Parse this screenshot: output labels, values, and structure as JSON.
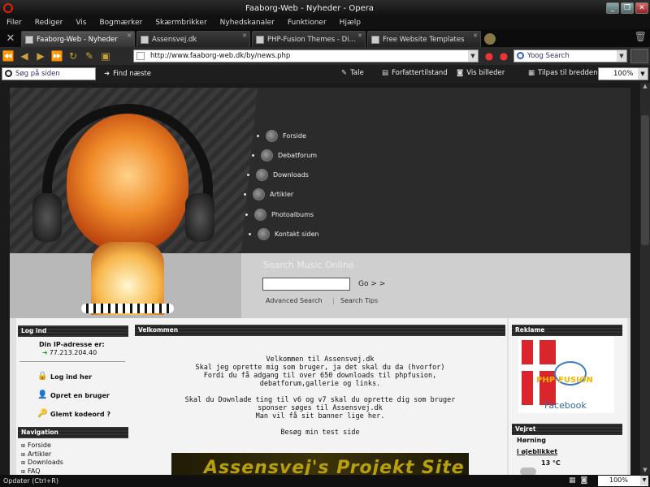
{
  "window": {
    "title": "Faaborg-Web - Nyheder - Opera",
    "buttons": [
      "_",
      "❐",
      "✕"
    ]
  },
  "menubar": [
    "Filer",
    "Rediger",
    "Vis",
    "Bogmærker",
    "Skærmbrikker",
    "Nyhedskanaler",
    "Funktioner",
    "Hjælp"
  ],
  "tabs": [
    {
      "label": "Faaborg-Web - Nyheder",
      "active": true
    },
    {
      "label": "Assensvej.dk",
      "active": false
    },
    {
      "label": "PHP-Fusion Themes - Di...",
      "active": false
    },
    {
      "label": "Free Website Templates",
      "active": false
    }
  ],
  "address": {
    "url": "http://www.faaborg-web.dk/by/news.php"
  },
  "search": {
    "value": "Yoog Search"
  },
  "toolbar2": {
    "find_placeholder": "Søg på siden",
    "find_next": "Find næste",
    "speak": "Tale",
    "author_mode": "Forfattertilstand",
    "show_images": "Vis billeder",
    "fit_width": "Tilpas til bredden",
    "zoom": "100%"
  },
  "site": {
    "nav": [
      "Forside",
      "Debatforum",
      "Downloads",
      "Artikler",
      "Photoalbums",
      "Kontakt siden"
    ],
    "search_title": "Search Music Online",
    "go": "Go > >",
    "advanced": "Advanced Search",
    "tips": "Search Tips",
    "login_header": "Log ind",
    "ip_label": "Din IP-adresse er:",
    "ip_value": "77.213.204.40",
    "login_link": "Log ind her",
    "register_link": "Opret en bruger",
    "forgot_link": "Glemt kodeord ?",
    "nav_header": "Navigation",
    "nav_links": [
      "Forside",
      "Artikler",
      "Downloads",
      "FAQ"
    ],
    "welcome_header": "Velkommen",
    "welcome_lines": [
      "Velkommen til Assensvej.dk",
      "Skal jeg oprette mig som bruger, ja det skal du da (hvorfor)",
      "Fordi du få adgang til over 650 downloads til phpfusion,",
      "debatforum,gallerie og links.",
      "",
      "Skal du Downlade ting til v6 og v7 skal du oprette dig som bruger",
      "sponser søges til Assensvej.dk",
      "Man vil få sit banner lige her.",
      "",
      "Besøg min test side"
    ],
    "banner_text": "Assensvej's Projekt Site",
    "ad_header": "Reklame",
    "ad_brand": "PHP-FUSION",
    "ad_facebook": "Facebook",
    "weather_header": "Vejret",
    "weather_city": "Hørning",
    "weather_now": "i øjeblikket",
    "weather_temp": "13 °C"
  },
  "status": {
    "text": "Opdater (Ctrl+R)",
    "zoom": "100%"
  }
}
